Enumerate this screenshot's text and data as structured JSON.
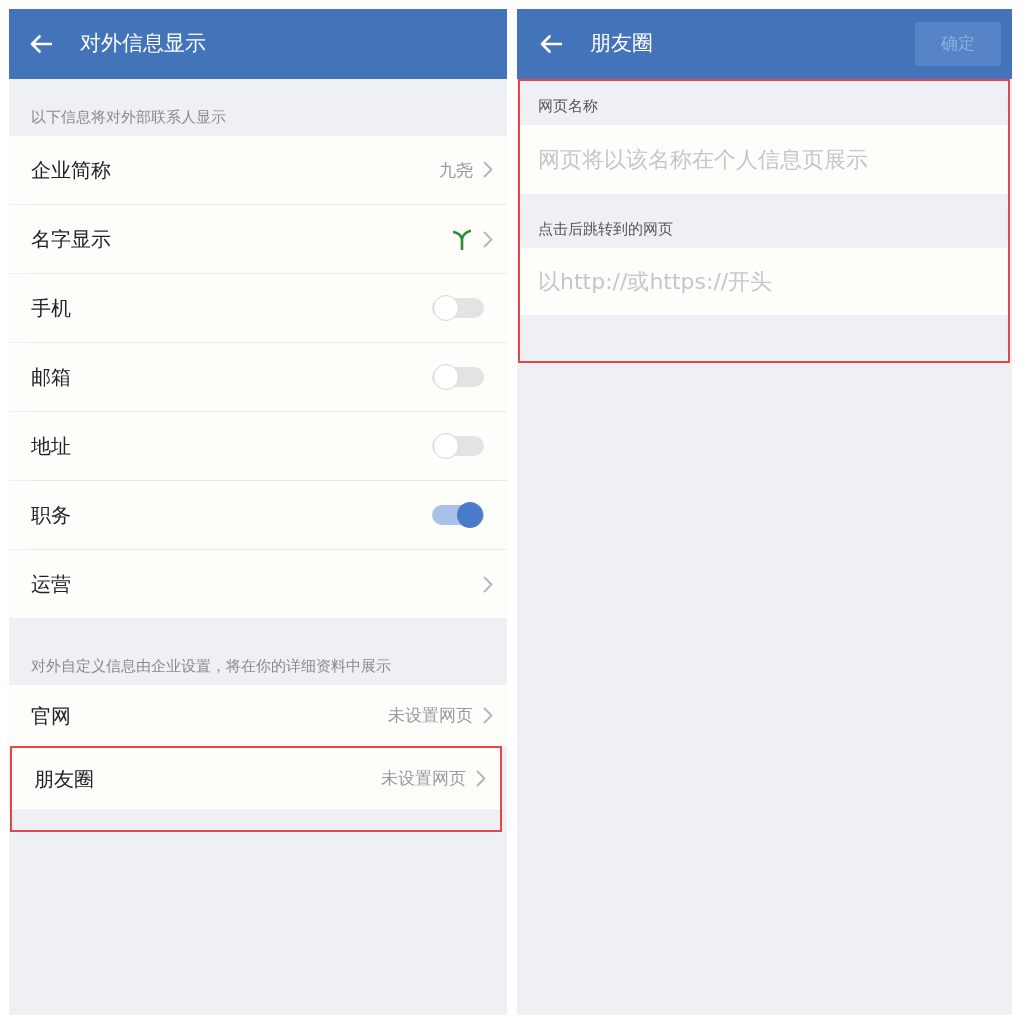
{
  "left_screen": {
    "title": "对外信息显示",
    "sections": [
      {
        "caption": "以下信息将对外部联系人显示",
        "rows": [
          {
            "kind": "value",
            "label": "企业简称",
            "value": "九尧",
            "highlighted": false
          },
          {
            "kind": "icon",
            "label": "名字显示",
            "highlighted": false
          },
          {
            "kind": "toggle",
            "label": "手机",
            "on": false,
            "highlighted": false
          },
          {
            "kind": "toggle",
            "label": "邮箱",
            "on": false,
            "highlighted": false
          },
          {
            "kind": "toggle",
            "label": "地址",
            "on": false,
            "highlighted": false
          },
          {
            "kind": "toggle",
            "label": "职务",
            "on": true,
            "highlighted": false
          },
          {
            "kind": "link",
            "label": "运营",
            "highlighted": false
          }
        ]
      },
      {
        "caption": "对外自定义信息由企业设置，将在你的详细资料中展示",
        "rows": [
          {
            "kind": "value",
            "label": "官网",
            "value": "未设置网页",
            "highlighted": false
          },
          {
            "kind": "value",
            "label": "朋友圈",
            "value": "未设置网页",
            "highlighted": true
          }
        ]
      }
    ]
  },
  "right_screen": {
    "title": "朋友圈",
    "confirm_button": {
      "label": "确定",
      "disabled": true
    },
    "highlighted": true,
    "fields": [
      {
        "label": "网页名称",
        "placeholder": "网页将以该名称在个人信息页展示"
      },
      {
        "label": "点击后跳转到的网页",
        "placeholder": "以http://或https://开头"
      }
    ]
  }
}
